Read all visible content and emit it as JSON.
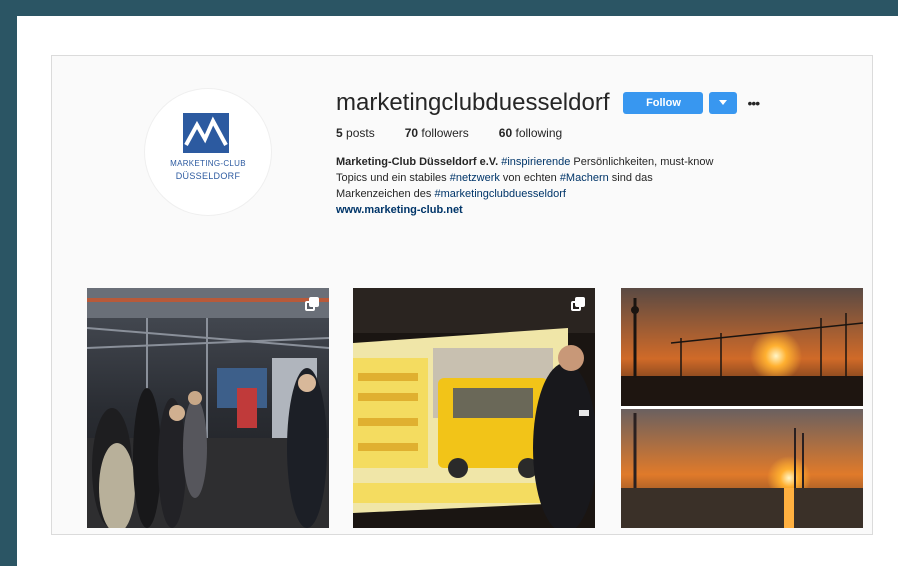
{
  "profile": {
    "username": "marketingclubduesseldorf",
    "follow_label": "Follow",
    "dropdown_icon": "chevron-down-icon",
    "more_icon": "ellipsis-icon",
    "stats": {
      "posts": "5",
      "posts_label": "posts",
      "followers": "70",
      "followers_label": "followers",
      "following": "60",
      "following_label": "following"
    },
    "bio": {
      "full_name": "Marketing-Club Düsseldorf e.V.",
      "line1_tag": "#inspirierende",
      "line1_rest": " Persönlichkeiten, must-know",
      "line2_start": "Topics und ein stabiles ",
      "line2_tag1": "#netzwerk",
      "line2_mid": " von echten ",
      "line2_tag2": "#Machern",
      "line2_end": " sind das",
      "line3_start": "Markenzeichen des ",
      "line3_tag": "#marketingclubduesseldorf"
    },
    "website": "www.marketing-club.net"
  },
  "avatar": {
    "line1": "MARKETING-CLUB",
    "line2": "DÜSSELDORF",
    "brand_color": "#2c5aa0"
  },
  "posts": [
    {
      "kind": "event-hall",
      "multi": true
    },
    {
      "kind": "presentation",
      "multi": true
    },
    {
      "kind": "sunset",
      "multi": false
    }
  ],
  "colors": {
    "background": "#2b5564",
    "follow_button": "#3897f0",
    "hashtag": "#003569"
  }
}
